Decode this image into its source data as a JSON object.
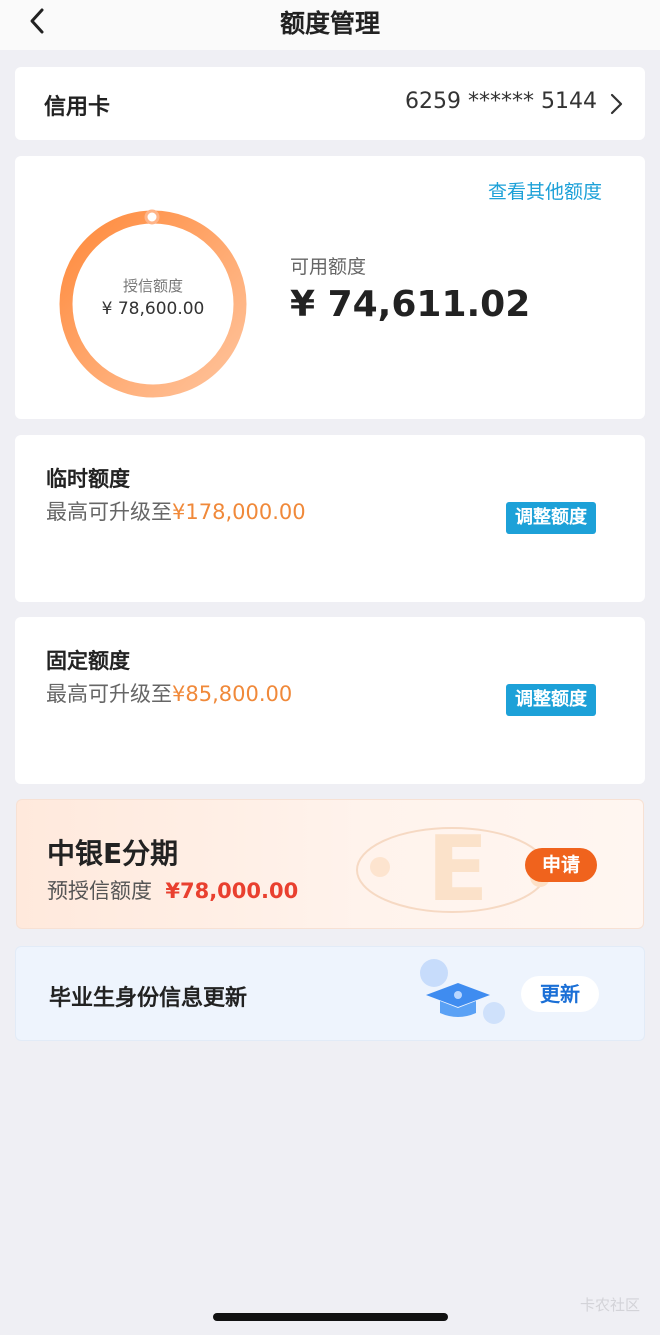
{
  "header": {
    "title": "额度管理"
  },
  "card_selector": {
    "label": "信用卡",
    "card_number": "6259 ****** 5144"
  },
  "limit": {
    "other_link": "查看其他额度",
    "ring_label": "授信额度",
    "ring_value": "¥ 78,600.00",
    "available_label": "可用额度",
    "available_value": "¥ 74,611.02"
  },
  "temp_limit": {
    "title": "临时额度",
    "sub_prefix": "最高可升级至",
    "sub_amount": "¥178,000.00",
    "button": "调整额度"
  },
  "fixed_limit": {
    "title": "固定额度",
    "sub_prefix": "最高可升级至",
    "sub_amount": "¥85,800.00",
    "button": "调整额度"
  },
  "e_installment": {
    "title": "中银E分期",
    "sub_prefix": "预授信额度",
    "sub_amount": "¥78,000.00",
    "button": "申请"
  },
  "graduate": {
    "title": "毕业生身份信息更新",
    "button": "更新"
  },
  "watermark": "卡农社区",
  "colors": {
    "accent_blue": "#1da1d8",
    "accent_orange": "#f0893a",
    "apply_orange": "#f0631d",
    "red_amount": "#e9402f"
  },
  "icons": [
    "back-chevron-icon",
    "right-chevron-icon",
    "graduation-cap-icon"
  ]
}
